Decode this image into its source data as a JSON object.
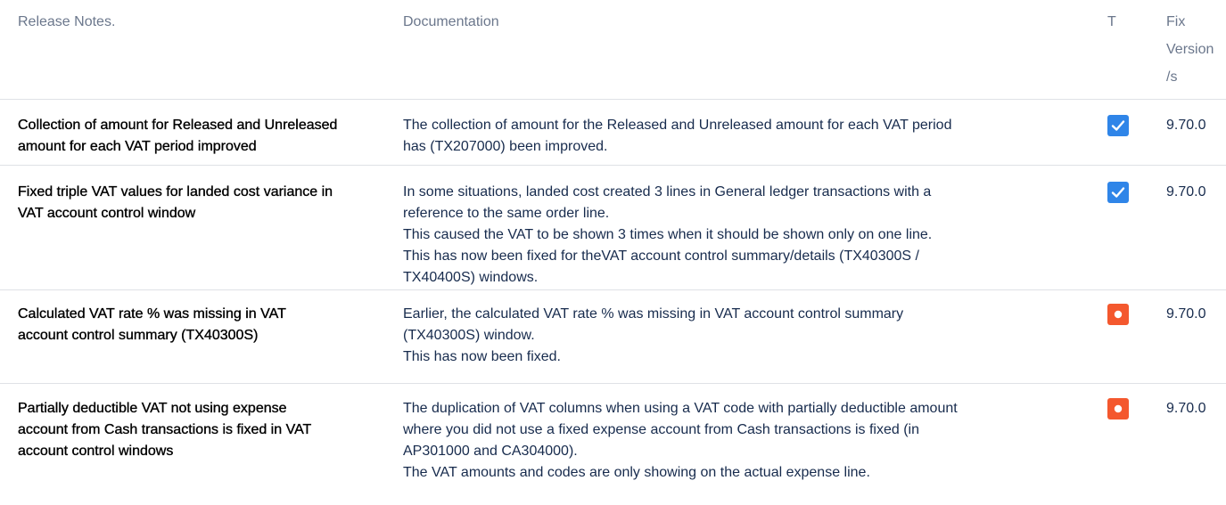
{
  "header": {
    "release_notes": "Release Notes.",
    "documentation": "Documentation",
    "t": "T",
    "fix_version": [
      "Fix",
      "Version",
      "/s"
    ]
  },
  "colors": {
    "done": "#2f85e8",
    "todo": "#f4582e",
    "header_text": "#6b778c",
    "divider": "#dfe1e6"
  },
  "rows": [
    {
      "title": "Collection of amount for Released and Unreleased amount for each VAT period improved",
      "title_lines": [
        "Collection of amount for Released and Unreleased",
        "amount for each VAT period improved"
      ],
      "doc_lines": [
        "The collection of amount for the Released and Unreleased amount for each VAT period",
        "has (TX207000) been improved."
      ],
      "status_icon": "checkbox-checked-icon",
      "version": "9.70.0"
    },
    {
      "title": "Fixed triple VAT values for landed cost variance in VAT account control window",
      "title_lines": [
        "Fixed triple VAT values for landed cost variance in",
        "VAT account control window"
      ],
      "doc_lines": [
        "In some situations, landed cost created 3 lines in General ledger transactions with a",
        "reference to the same order line.",
        "This caused the VAT to be shown 3 times when it should be shown only on one line.",
        "This has now been fixed for theVAT account control summary/details (TX40300S /",
        "TX40400S) windows."
      ],
      "status_icon": "checkbox-checked-icon",
      "version": "9.70.0"
    },
    {
      "title": "Calculated VAT rate % was missing in VAT account control summary (TX40300S)",
      "title_lines": [
        "Calculated VAT rate % was missing in VAT",
        "account control summary (TX40300S)"
      ],
      "doc_lines": [
        "Earlier, the calculated VAT rate % was missing in VAT account control summary",
        "(TX40300S) window.",
        "This has now been fixed."
      ],
      "status_icon": "radio-dot-icon",
      "version": "9.70.0"
    },
    {
      "title": "Partially deductible VAT not using expense account from Cash transactions is fixed in VAT account control windows",
      "title_lines": [
        "Partially deductible VAT not using expense",
        "account from Cash transactions is fixed in VAT",
        "account control windows"
      ],
      "doc_lines": [
        "The duplication of VAT columns when using a VAT code with partially deductible amount",
        "where you did not use a fixed expense account from Cash transactions is fixed (in",
        "AP301000 and CA304000).",
        "The VAT amounts and codes are only showing on the actual expense line."
      ],
      "status_icon": "radio-dot-icon",
      "version": "9.70.0"
    }
  ]
}
